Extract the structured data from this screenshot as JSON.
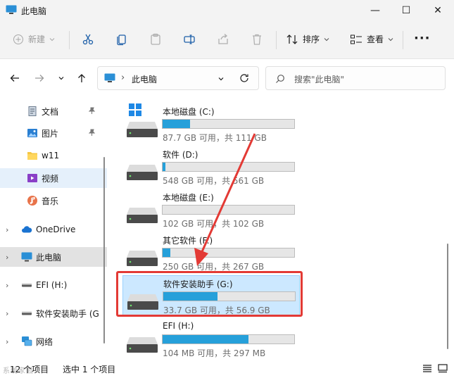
{
  "window": {
    "title": "此电脑",
    "minimize_glyph": "—",
    "maximize_glyph": "☐",
    "close_glyph": "✕"
  },
  "toolbar": {
    "new_label": "新建",
    "sort_label": "排序",
    "view_label": "查看",
    "more_label": "···",
    "icons": [
      "cut-icon",
      "copy-icon",
      "paste-icon",
      "rename-icon",
      "share-icon",
      "delete-icon"
    ]
  },
  "address": {
    "location": "此电脑",
    "separator": "›",
    "search_placeholder": "搜索\"此电脑\""
  },
  "sidebar": {
    "items": [
      {
        "label": "文档",
        "pinned": true
      },
      {
        "label": "图片",
        "pinned": true
      },
      {
        "label": "w11"
      },
      {
        "label": "视频"
      },
      {
        "label": "音乐"
      },
      {
        "label": "OneDrive"
      },
      {
        "label": "此电脑"
      },
      {
        "label": "EFI (H:)"
      },
      {
        "label": "软件安装助手 (G"
      },
      {
        "label": "网络"
      }
    ]
  },
  "drives": [
    {
      "name": "本地磁盘 (C:)",
      "capacity": "87.7 GB 可用，共 111 GB",
      "used_fraction": 0.21,
      "type": "system"
    },
    {
      "name": "软件 (D:)",
      "capacity": "548 GB 可用，共 561 GB",
      "used_fraction": 0.02,
      "type": "hdd"
    },
    {
      "name": "本地磁盘 (E:)",
      "capacity": "102 GB 可用，共 102 GB",
      "used_fraction": 0.0,
      "type": "hdd"
    },
    {
      "name": "其它软件 (F:)",
      "capacity": "250 GB 可用，共 267 GB",
      "used_fraction": 0.06,
      "type": "hdd"
    },
    {
      "name": "软件安装助手 (G:)",
      "capacity": "33.7 GB 可用，共 56.9 GB",
      "used_fraction": 0.41,
      "type": "hdd",
      "selected": true
    },
    {
      "name": "EFI (H:)",
      "capacity": "104 MB 可用，共 297 MB",
      "used_fraction": 0.65,
      "type": "hdd"
    }
  ],
  "status": {
    "item_count": "12 个项目",
    "selection": "选中 1 个项目",
    "watermark": "系统家园"
  },
  "colors": {
    "accent": "#26a0da",
    "selection": "#cce8ff",
    "annotation": "#e33a35"
  }
}
